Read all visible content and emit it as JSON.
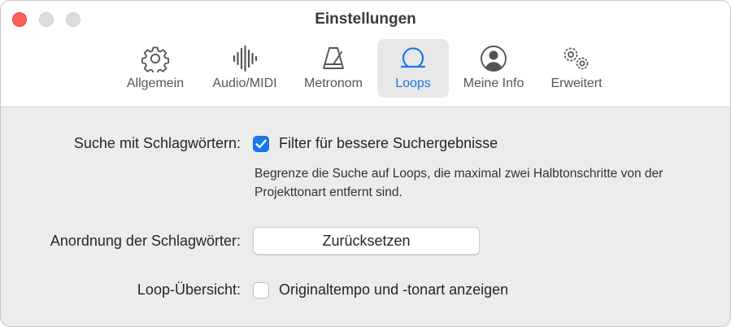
{
  "window": {
    "title": "Einstellungen"
  },
  "tabs": [
    {
      "label": "Allgemein",
      "icon": "gear-icon",
      "active": false
    },
    {
      "label": "Audio/MIDI",
      "icon": "waveform-icon",
      "active": false
    },
    {
      "label": "Metronom",
      "icon": "metronome-icon",
      "active": false
    },
    {
      "label": "Loops",
      "icon": "loop-icon",
      "active": true
    },
    {
      "label": "Meine Info",
      "icon": "person-circle-icon",
      "active": false
    },
    {
      "label": "Erweitert",
      "icon": "gears-icon",
      "active": false
    }
  ],
  "settings": {
    "keyword_search": {
      "label": "Suche mit Schlagwörtern:",
      "checkbox_label": "Filter für bessere Suchergebnisse",
      "checked": true,
      "description": "Begrenze die Suche auf Loops, die maximal zwei Halbtonschritte von der Projekttonart entfernt sind."
    },
    "keyword_layout": {
      "label": "Anordnung der Schlagwörter:",
      "button_label": "Zurücksetzen"
    },
    "loop_browser": {
      "label": "Loop-Übersicht:",
      "checkbox_label": "Originaltempo und -tonart anzeigen",
      "checked": false
    }
  },
  "colors": {
    "accent": "#1a78e6",
    "close": "#fe5f57"
  }
}
